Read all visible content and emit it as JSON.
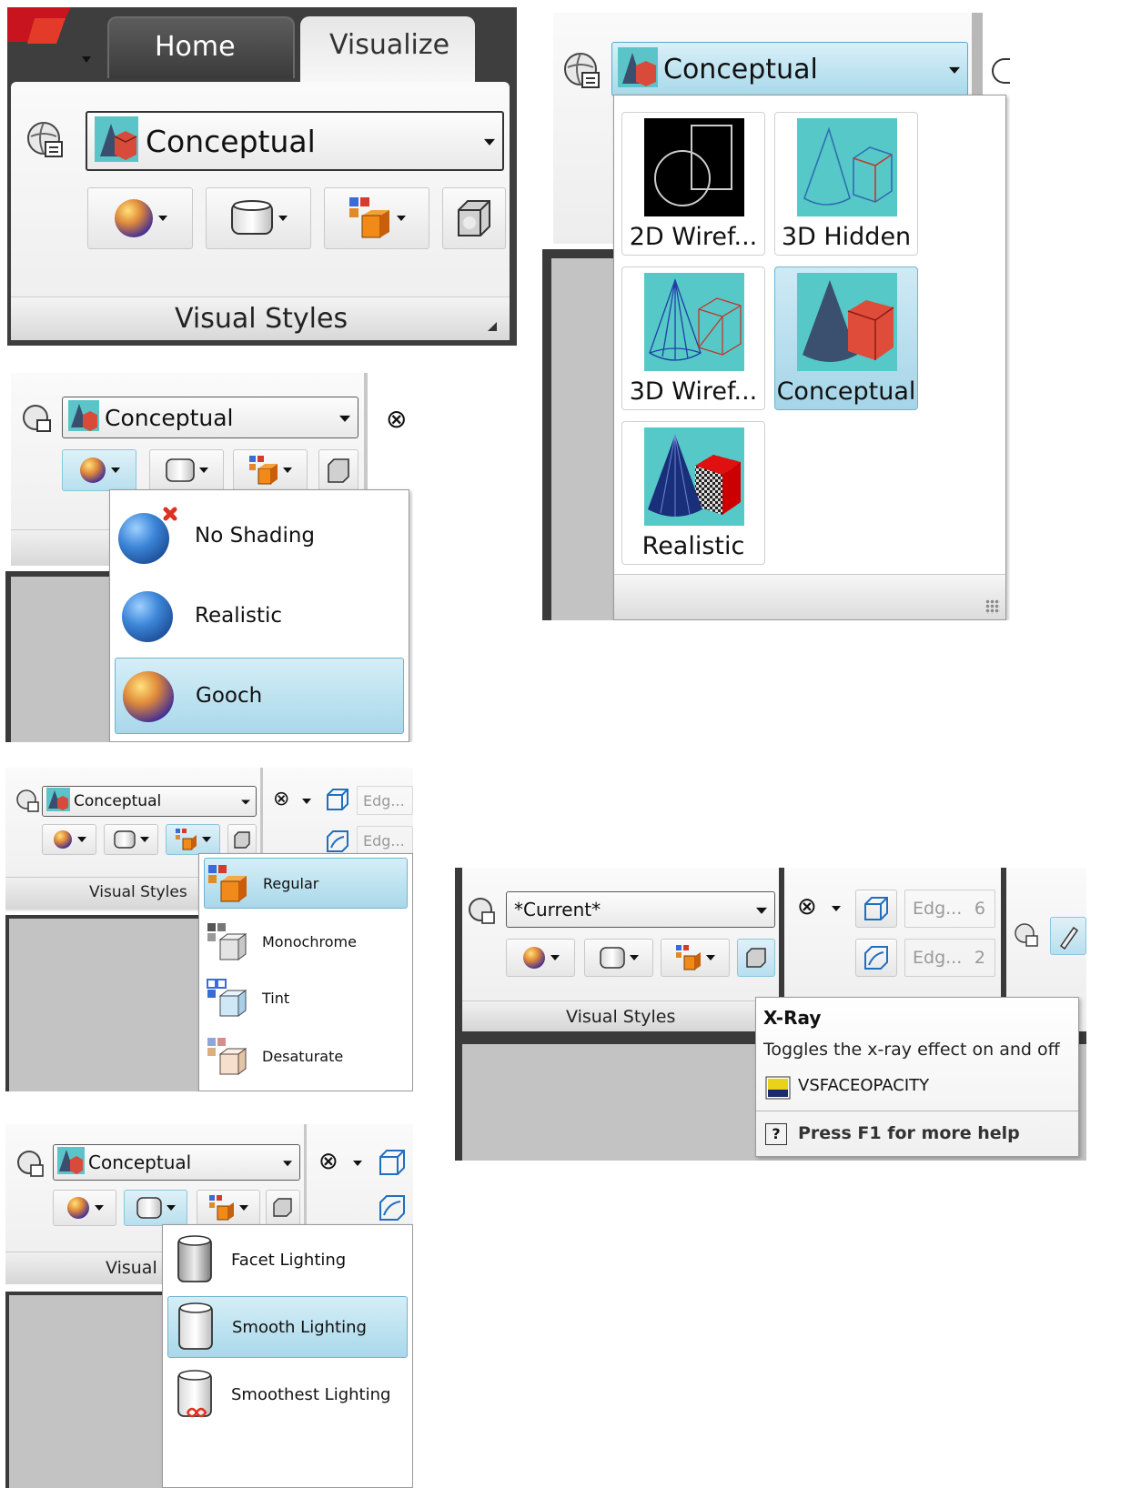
{
  "panel1": {
    "tabs": [
      "Home",
      "Visualize"
    ],
    "combo": "Conceptual",
    "title": "Visual Styles"
  },
  "panel2": {
    "combo": "Conceptual",
    "tiles": [
      "2D Wiref...",
      "3D Hidden",
      "3D Wiref...",
      "Conceptual",
      "Realistic"
    ]
  },
  "panel3": {
    "combo": "Conceptual",
    "menu": [
      "No Shading",
      "Realistic",
      "Gooch"
    ]
  },
  "panel4": {
    "combo": "Conceptual",
    "edge": [
      "Edg...",
      "Edg..."
    ],
    "title": "Visual Styles",
    "menu": [
      "Regular",
      "Monochrome",
      "Tint",
      "Desaturate"
    ]
  },
  "panel5": {
    "combo": "*Current*",
    "edge": [
      "Edg...",
      "Edg..."
    ],
    "edge_vals": [
      "6",
      "2"
    ],
    "title": "Visual Styles",
    "tooltip": {
      "title": "X-Ray",
      "desc": "Toggles the x-ray effect on and off",
      "cmd": "VSFACEOPACITY",
      "help": "Press F1 for more help"
    }
  },
  "panel6": {
    "combo": "Conceptual",
    "title": "Visual",
    "menu": [
      "Facet Lighting",
      "Smooth Lighting",
      "Smoothest Lighting"
    ]
  },
  "colors": {
    "accent": "#a9d8ea",
    "cyan": "#56c8c8",
    "red": "#e05040"
  }
}
